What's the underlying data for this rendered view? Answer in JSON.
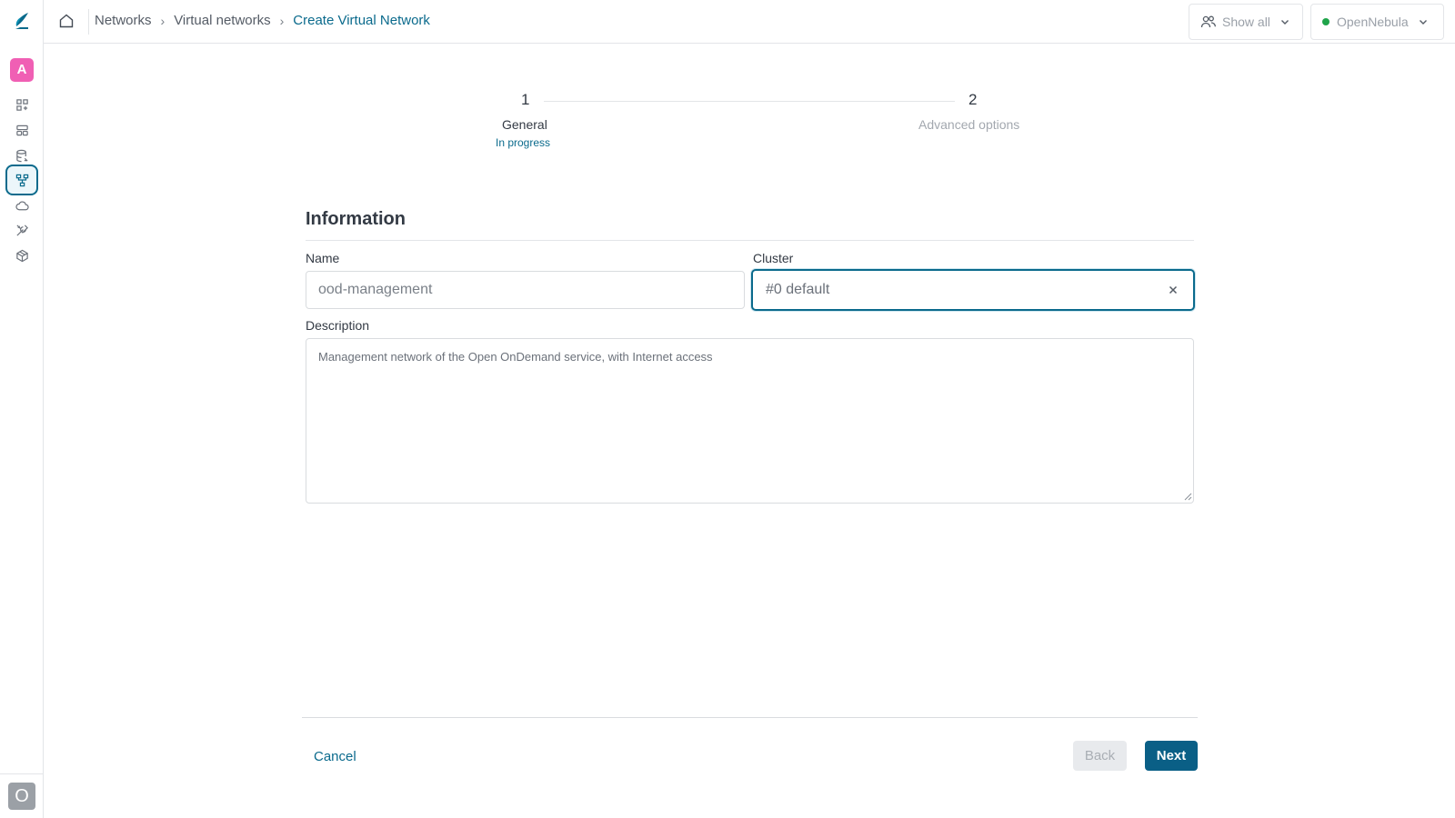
{
  "sidebar": {
    "logo_icon": "opennebula-logo-icon",
    "user_avatar": "A",
    "items": [
      {
        "icon": "dashboard-icon",
        "active": false
      },
      {
        "icon": "instances-icon",
        "active": false
      },
      {
        "icon": "storage-icon",
        "active": false
      },
      {
        "icon": "network-icon",
        "active": true
      },
      {
        "icon": "cloud-icon",
        "active": false
      },
      {
        "icon": "tools-icon",
        "active": false
      },
      {
        "icon": "infrastructure-icon",
        "active": false
      }
    ],
    "bottom_avatar": "O"
  },
  "header": {
    "breadcrumb": [
      "Networks",
      "Virtual networks",
      "Create Virtual Network"
    ],
    "group_selector": "Show all",
    "zone_selector": "OpenNebula",
    "zone_status_color": "#1fa44a"
  },
  "stepper": {
    "steps": [
      {
        "number": "1",
        "label": "General",
        "status": "In progress"
      },
      {
        "number": "2",
        "label": "Advanced options",
        "status": ""
      }
    ]
  },
  "form": {
    "section_title": "Information",
    "name_label": "Name",
    "name_value": "ood-management",
    "cluster_label": "Cluster",
    "cluster_value": "#0 default",
    "description_label": "Description",
    "description_value": "Management network of the Open OnDemand service, with Internet access"
  },
  "footer": {
    "cancel_label": "Cancel",
    "back_label": "Back",
    "next_label": "Next"
  },
  "colors": {
    "accent": "#0a6a8c",
    "primary_button": "#0a5f86",
    "avatar": "#f05fb4"
  }
}
